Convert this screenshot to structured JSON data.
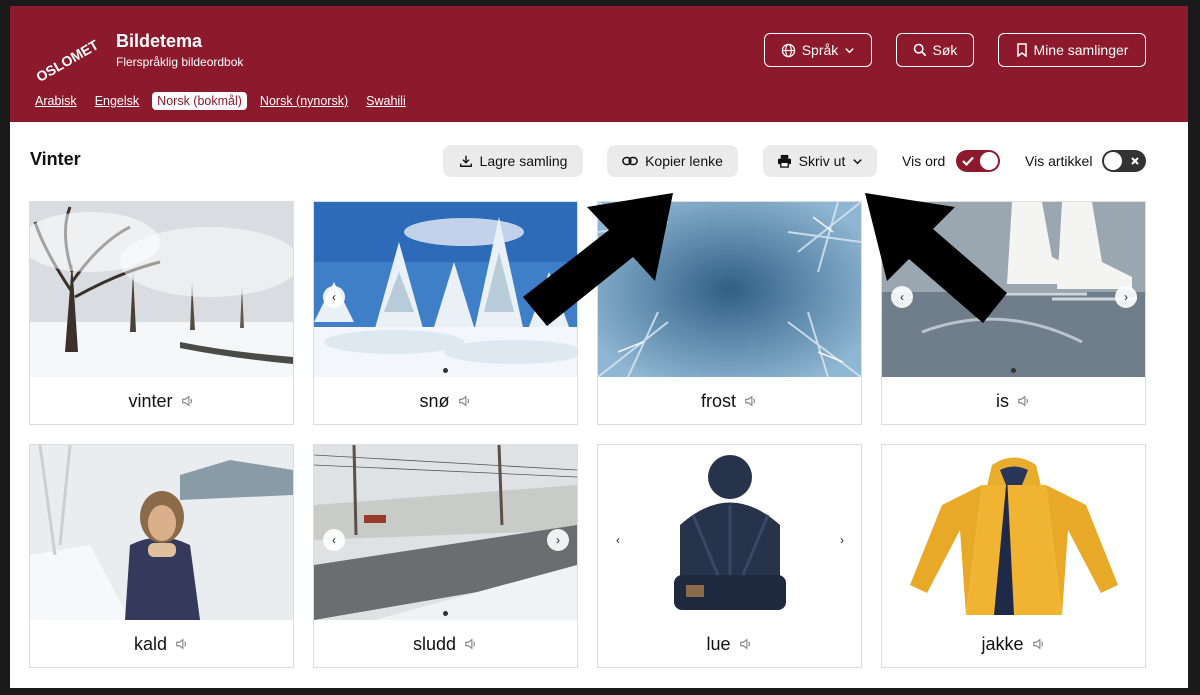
{
  "header": {
    "logo_text": "OSLOMET",
    "title": "Bildetema",
    "subtitle": "Flerspråklig bildeordbok",
    "language_button": "Språk",
    "search_button": "Søk",
    "collections_button": "Mine samlinger"
  },
  "languages": [
    "Arabisk",
    "Engelsk",
    "Norsk (bokmål)",
    "Norsk (nynorsk)",
    "Swahili"
  ],
  "active_language": "Norsk (bokmål)",
  "toolbar": {
    "title": "Vinter",
    "save_label": "Lagre samling",
    "copy_link_label": "Kopier lenke",
    "print_label": "Skriv ut",
    "show_words_label": "Vis ord",
    "show_words_on": true,
    "show_article_label": "Vis artikkel",
    "show_article_on": false
  },
  "cards": [
    {
      "word": "vinter",
      "image": "snowy-trees"
    },
    {
      "word": "snø",
      "image": "snowy-firs"
    },
    {
      "word": "frost",
      "image": "frost-pattern"
    },
    {
      "word": "is",
      "image": "ice-skates"
    },
    {
      "word": "kald",
      "image": "cold-person"
    },
    {
      "word": "sludd",
      "image": "slushy-road"
    },
    {
      "word": "lue",
      "image": "knit-hat"
    },
    {
      "word": "jakke",
      "image": "yellow-jacket"
    }
  ],
  "colors": {
    "brand": "#8c1a2c",
    "button_bg": "#ebebeb",
    "toggle_off": "#333333"
  }
}
